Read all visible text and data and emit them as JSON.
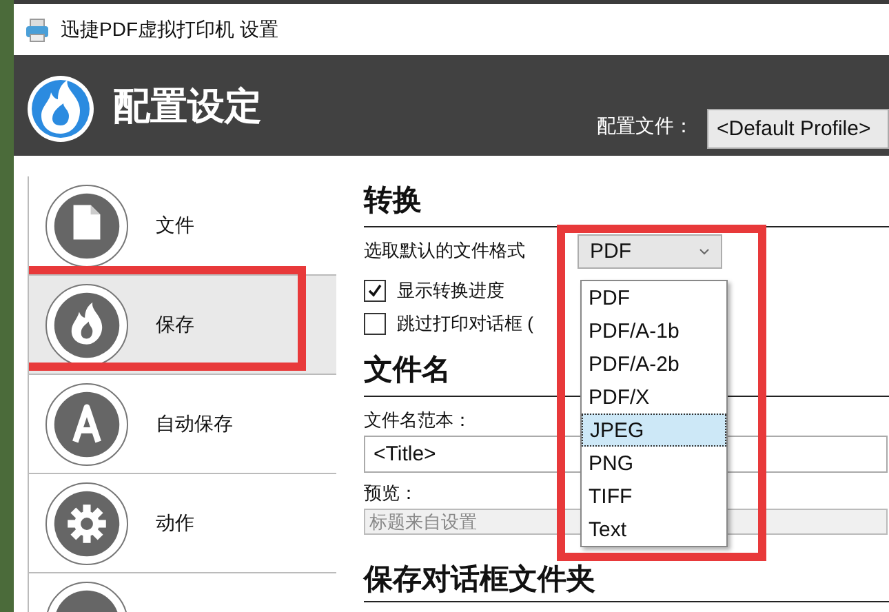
{
  "window": {
    "title": "迅捷PDF虚拟打印机 设置"
  },
  "header": {
    "title": "配置设定",
    "profile_label": "配置文件：",
    "profile_value": "<Default Profile>"
  },
  "sidebar": {
    "items": [
      {
        "label": "文件",
        "kind": "document",
        "selected": false,
        "highlighted": false
      },
      {
        "label": "保存",
        "kind": "flame",
        "selected": true,
        "highlighted": true
      },
      {
        "label": "自动保存",
        "kind": "letter",
        "selected": false,
        "highlighted": false
      },
      {
        "label": "动作",
        "kind": "gear",
        "selected": false,
        "highlighted": false
      },
      {
        "kind": "blank",
        "selected": false,
        "highlighted": false
      }
    ]
  },
  "conversion": {
    "heading": "转换",
    "format_label": "选取默认的文件格式",
    "format_value": "PDF",
    "dropdown": {
      "expanded": true,
      "highlighted": true,
      "options": [
        {
          "label": "PDF",
          "selected": false
        },
        {
          "label": "PDF/A-1b",
          "selected": false
        },
        {
          "label": "PDF/A-2b",
          "selected": false
        },
        {
          "label": "PDF/X",
          "selected": false
        },
        {
          "label": "JPEG",
          "selected": true
        },
        {
          "label": "PNG",
          "selected": false
        },
        {
          "label": "TIFF",
          "selected": false
        },
        {
          "label": "Text",
          "selected": false
        }
      ]
    },
    "checkboxes": [
      {
        "label": "显示转换进度",
        "checked": true
      },
      {
        "label": "跳过打印对话框 (",
        "checked": false
      }
    ]
  },
  "filename": {
    "heading": "文件名",
    "template_label": "文件名范本：",
    "template_value": "<Title>",
    "preview_label": "预览：",
    "preview_value": "标题来自设置"
  },
  "save_dialog": {
    "heading": "保存对话框文件夹"
  }
}
